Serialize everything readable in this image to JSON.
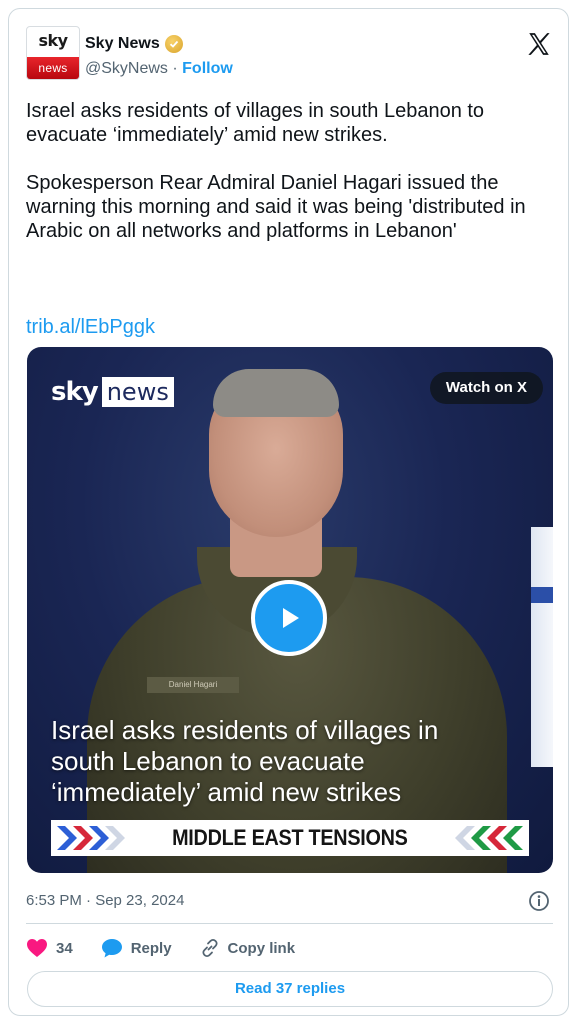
{
  "author": {
    "avatar_top": "sky",
    "avatar_bottom": "news",
    "display_name": "Sky News",
    "handle": "@SkyNews",
    "separator": "·",
    "follow_label": "Follow",
    "verified_color": "#e2b13c"
  },
  "tweet": {
    "text": "Israel asks residents of villages in south Lebanon to evacuate ‘immediately’ amid new strikes.\n\nSpokesperson Rear Admiral Daniel Hagari issued the warning this morning and said it was being 'distributed in Arabic on all networks and platforms in Lebanon'",
    "link": "trib.al/lEbPggk"
  },
  "media": {
    "logo_sky": "sky",
    "logo_news": "news",
    "watch_label": "Watch on X",
    "name_tag": "Daniel Hagari",
    "caption": "Israel asks residents of villages in\nsouth Lebanon to evacuate\n‘immediately’ amid new strikes",
    "banner": "MIDDLE EAST TENSIONS"
  },
  "footer": {
    "timestamp": "6:53 PM · Sep 23, 2024",
    "likes_count": "34",
    "reply_label": "Reply",
    "copy_label": "Copy link",
    "read_replies_label": "Read 37 replies"
  },
  "colors": {
    "accent": "#1d9bf0",
    "like": "#f91880",
    "text_secondary": "#536471"
  },
  "icons": [
    "x-logo-icon",
    "verified-badge-icon",
    "play-icon",
    "info-icon",
    "heart-icon",
    "reply-bubble-icon",
    "link-icon"
  ]
}
